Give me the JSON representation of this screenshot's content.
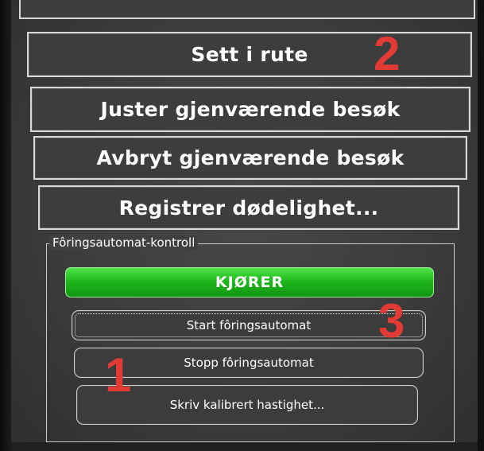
{
  "menu": {
    "route_label": "Sett i rute",
    "adjust_visits_label": "Juster gjenværende besøk",
    "cancel_visits_label": "Avbryt gjenværende besøk",
    "register_mortality_label": "Registrer dødelighet..."
  },
  "feeder_control": {
    "legend": "Fôringsautomat-kontroll",
    "status": "KJØRER",
    "start_label": "Start fôringsautomat",
    "stop_label": "Stopp fôringsautomat",
    "calibrate_label": "Skriv kalibrert hastighet..."
  },
  "annotations": {
    "marker_1": "1",
    "marker_2": "2",
    "marker_3": "3",
    "color": "#e23a34"
  },
  "colors": {
    "status_green": "#1fb81c",
    "button_border": "#d8d8d8",
    "panel_bg": "#3d3d3d"
  }
}
